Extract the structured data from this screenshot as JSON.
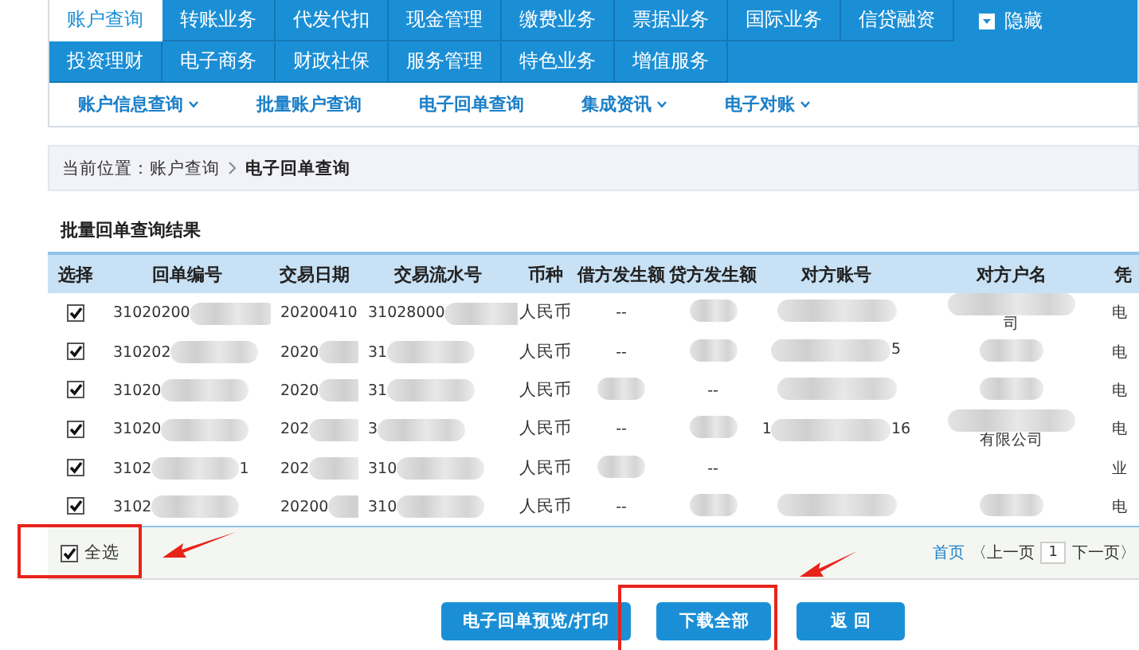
{
  "main_tabs": [
    {
      "label": "账户查询",
      "selected": true
    },
    {
      "label": "转账业务",
      "selected": false
    },
    {
      "label": "代发代扣",
      "selected": false
    },
    {
      "label": "现金管理",
      "selected": false
    },
    {
      "label": "缴费业务",
      "selected": false
    },
    {
      "label": "票据业务",
      "selected": false
    },
    {
      "label": "国际业务",
      "selected": false
    },
    {
      "label": "信贷融资",
      "selected": false
    },
    {
      "label": "投资理财",
      "selected": false
    },
    {
      "label": "电子商务",
      "selected": false
    },
    {
      "label": "财政社保",
      "selected": false
    },
    {
      "label": "服务管理",
      "selected": false
    },
    {
      "label": "特色业务",
      "selected": false
    },
    {
      "label": "增值服务",
      "selected": false
    }
  ],
  "hide_toggle": {
    "label": "隐藏"
  },
  "sub_nav": [
    {
      "label": "账户信息查询",
      "has_menu": true
    },
    {
      "label": "批量账户查询",
      "has_menu": false
    },
    {
      "label": "电子回单查询",
      "has_menu": false
    },
    {
      "label": "集成资讯",
      "has_menu": true
    },
    {
      "label": "电子对账",
      "has_menu": true
    }
  ],
  "breadcrumb": {
    "prefix": "当前位置：账户查询",
    "current": "电子回单查询"
  },
  "section_title": "批量回单查询结果",
  "table": {
    "select_header": "选择",
    "columns": [
      "回单编号",
      "交易日期",
      "交易流水号",
      "币种",
      "借方发生额",
      "贷方发生额",
      "对方账号",
      "对方户名",
      "凭"
    ],
    "rows": [
      {
        "checked": true,
        "cells": [
          {
            "text": "31020200",
            "blurred": true
          },
          {
            "text": "20200410",
            "blurred": false
          },
          {
            "text": "31028000",
            "blurred": true
          },
          {
            "text": "人民币",
            "blurred": false
          },
          {
            "text": "--",
            "blurred": false
          },
          {
            "blurred": true
          },
          {
            "blurred": true
          },
          {
            "after": "司",
            "blurred": true
          },
          {
            "text": "电",
            "blurred": false
          }
        ]
      },
      {
        "checked": true,
        "cells": [
          {
            "text": "310202",
            "blurred": true
          },
          {
            "text": "2020",
            "blurred": true
          },
          {
            "text": "31",
            "blurred": true
          },
          {
            "text": "人民币",
            "blurred": false
          },
          {
            "text": "--",
            "blurred": false
          },
          {
            "blurred": true
          },
          {
            "after": "5",
            "blurred": true
          },
          {
            "blurred": true
          },
          {
            "text": "电",
            "blurred": false
          }
        ]
      },
      {
        "checked": true,
        "cells": [
          {
            "text": "31020",
            "blurred": true
          },
          {
            "text": "2020",
            "blurred": true
          },
          {
            "text": "31",
            "blurred": true
          },
          {
            "text": "人民币",
            "blurred": false
          },
          {
            "blurred": true
          },
          {
            "text": "--",
            "blurred": false
          },
          {
            "blurred": true
          },
          {
            "blurred": true
          },
          {
            "text": "电",
            "blurred": false
          }
        ]
      },
      {
        "checked": true,
        "cells": [
          {
            "text": "31020",
            "blurred": true
          },
          {
            "text": "202",
            "blurred": true
          },
          {
            "text": "3",
            "blurred": true
          },
          {
            "text": "人民币",
            "blurred": false
          },
          {
            "text": "--",
            "blurred": false
          },
          {
            "blurred": true
          },
          {
            "text": "1",
            "after": "16",
            "blurred": true
          },
          {
            "after": "有限公司",
            "blurred": true
          },
          {
            "text": "电",
            "blurred": false
          }
        ]
      },
      {
        "checked": true,
        "cells": [
          {
            "text": "3102",
            "after": "1",
            "blurred": true
          },
          {
            "text": "202",
            "blurred": true
          },
          {
            "text": "310",
            "blurred": true
          },
          {
            "text": "人民币",
            "blurred": false
          },
          {
            "blurred": true
          },
          {
            "text": "--",
            "blurred": false
          },
          {
            "blurred": false
          },
          {
            "blurred": false
          },
          {
            "text": "业",
            "blurred": false
          }
        ]
      },
      {
        "checked": true,
        "cells": [
          {
            "text": "3102",
            "blurred": true
          },
          {
            "text": "20200",
            "blurred": true
          },
          {
            "text": "310",
            "blurred": true
          },
          {
            "text": "人民币",
            "blurred": false
          },
          {
            "text": "--",
            "blurred": false
          },
          {
            "blurred": true
          },
          {
            "blurred": true
          },
          {
            "blurred": true
          },
          {
            "text": "电",
            "blurred": false
          }
        ]
      }
    ]
  },
  "select_all": {
    "label": "全选",
    "checked": true
  },
  "pagination": {
    "first": "首页",
    "prev": "〈上一页",
    "page": "1",
    "next": "下一页〉"
  },
  "buttons": [
    "电子回单预览/打印",
    "下载全部",
    "返 回"
  ]
}
